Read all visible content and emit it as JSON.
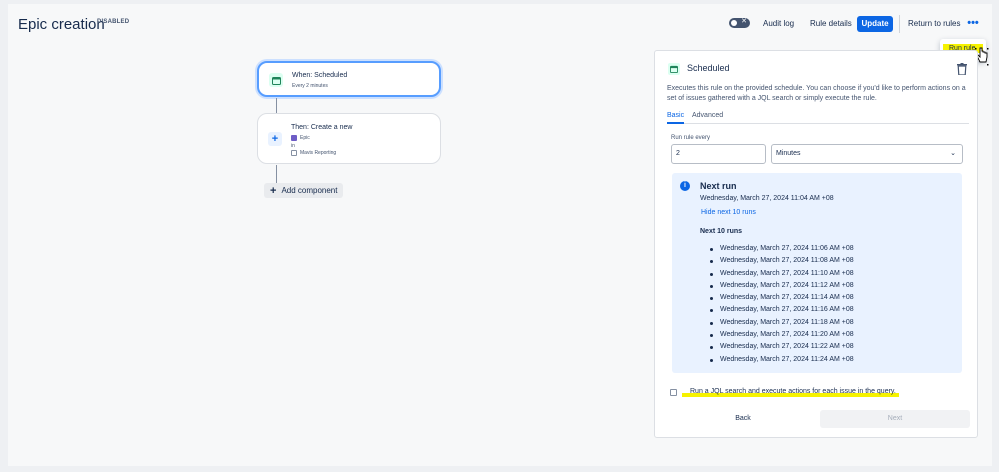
{
  "header": {
    "title": "Epic creation",
    "status": "DISABLED",
    "audit_log": "Audit log",
    "rule_details": "Rule details",
    "update": "Update",
    "return_to_rules": "Return to rules",
    "more": "•••"
  },
  "menu": {
    "run_rule": "Run rule"
  },
  "flow": {
    "trigger": {
      "title": "When: Scheduled",
      "subtitle": "Every 2 minutes"
    },
    "action": {
      "title": "Then: Create a new",
      "issue_type": "Epic",
      "in_label": "in",
      "project": "Mavis Reporting"
    },
    "add_component": "Add component"
  },
  "panel": {
    "title": "Scheduled",
    "description": "Executes this rule on the provided schedule. You can choose if you'd like to perform actions on a set of issues gathered with a JQL search or simply execute the rule.",
    "tabs": [
      {
        "label": "Basic",
        "active": true
      },
      {
        "label": "Advanced",
        "active": false
      }
    ],
    "run_every_label": "Run rule every",
    "run_every_value": "2",
    "unit_value": "Minutes",
    "next_run": {
      "title": "Next run",
      "date": "Wednesday, March 27, 2024 11:04 AM +08",
      "hide_link": "Hide next 10 runs",
      "next_ten_title": "Next 10 runs",
      "runs": [
        "Wednesday, March 27, 2024 11:06 AM +08",
        "Wednesday, March 27, 2024 11:08 AM +08",
        "Wednesday, March 27, 2024 11:10 AM +08",
        "Wednesday, March 27, 2024 11:12 AM +08",
        "Wednesday, March 27, 2024 11:14 AM +08",
        "Wednesday, March 27, 2024 11:16 AM +08",
        "Wednesday, March 27, 2024 11:18 AM +08",
        "Wednesday, March 27, 2024 11:20 AM +08",
        "Wednesday, March 27, 2024 11:22 AM +08",
        "Wednesday, March 27, 2024 11:24 AM +08"
      ]
    },
    "jql_label": "Run a JQL search and execute actions for each issue in the query.",
    "back": "Back",
    "next": "Next"
  },
  "colors": {
    "primary": "#0c66e4",
    "highlight": "#f6f200",
    "info_bg": "#e9f2ff"
  }
}
